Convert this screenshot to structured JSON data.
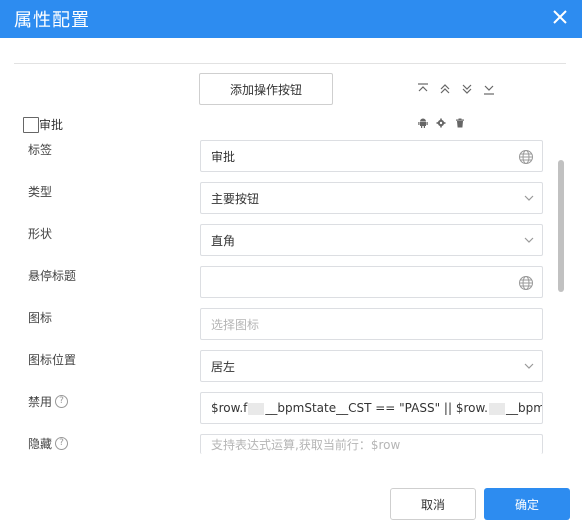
{
  "dialog": {
    "title": "属性配置",
    "accent_color": "#2d8cf0"
  },
  "toolbar": {
    "add_button_label": "添加操作按钮",
    "move_icons": [
      "move-top-icon",
      "move-up-icon",
      "move-down-icon",
      "move-bottom-icon"
    ],
    "tool_icons": [
      "android-icon",
      "gear-icon",
      "trash-icon"
    ]
  },
  "checkbox": {
    "label": "审批",
    "checked": false
  },
  "form": {
    "label_label": "标签",
    "label_value": "审批",
    "type_label": "类型",
    "type_value": "主要按钮",
    "shape_label": "形状",
    "shape_value": "直角",
    "tooltip_label": "悬停标题",
    "tooltip_value": "",
    "icon_label": "图标",
    "icon_placeholder": "选择图标",
    "icon_position_label": "图标位置",
    "icon_position_value": "居左",
    "disabled_label": "禁用",
    "disabled_value_a": "$row.f",
    "disabled_value_b": "__bpmState__CST == \"PASS\" || $row.",
    "disabled_value_c": "__bpm",
    "hidden_label": "隐藏",
    "hidden_placeholder": "支持表达式运算,获取当前行：$row"
  },
  "footer": {
    "cancel_label": "取消",
    "ok_label": "确定"
  }
}
